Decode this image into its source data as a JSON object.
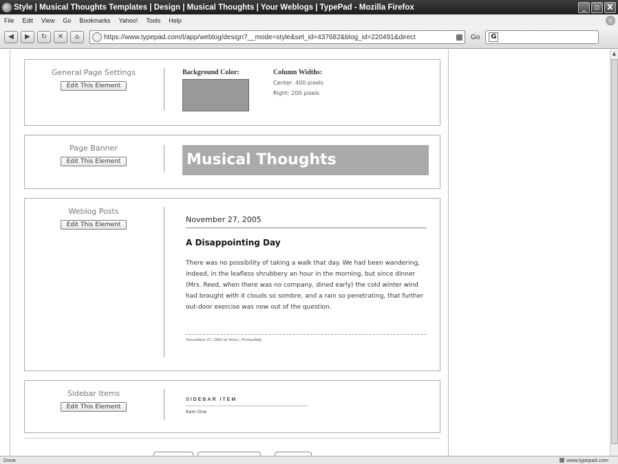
{
  "window": {
    "title": "Style | Musical Thoughts Templates | Design | Musical Thoughts | Your Weblogs | TypePad - Mozilla Firefox",
    "buttons": [
      "_",
      "▫",
      "X"
    ]
  },
  "menu": [
    "File",
    "Edit",
    "View",
    "Go",
    "Bookmarks",
    "Yahoo!",
    "Tools",
    "Help"
  ],
  "nav": {
    "url": "https://www.typepad.com/t/app/weblog/design?__mode=style&set_id=437682&blog_id=220491&direct",
    "go_label": "Go",
    "search_glyph": "G"
  },
  "sections": {
    "general": {
      "label": "General Page Settings",
      "edit": "Edit This Element",
      "bg_label": "Background Color:",
      "bg_color": "#999999",
      "col_label": "Column Widths:",
      "col_center": "Center: 400 pixels",
      "col_right": "Right: 200 pixels"
    },
    "banner": {
      "label": "Page Banner",
      "edit": "Edit This Element",
      "text": "Musical Thoughts"
    },
    "posts": {
      "label": "Weblog Posts",
      "edit": "Edit This Element",
      "date": "November 27, 2005",
      "title": "A Disappointing Day",
      "body": "There was no possibility of taking a walk that day. We had been wandering, indeed, in the leafless shrubbery an hour in the morning, but since dinner (Mrs. Reed, when there was no company, dined early) the cold winter wind had brought with it clouds so sombre, and a rain so penetrating, that further out-door exercise was now out of the question.",
      "footer": "November 27, 2005 in Woes | Permalink"
    },
    "sidebar": {
      "label": "Sidebar Items",
      "edit": "Edit This Element",
      "heading": "SIDEBAR ITEM",
      "item": "Item One"
    }
  },
  "status": {
    "text": "Done",
    "host": "www.typepad.com"
  }
}
